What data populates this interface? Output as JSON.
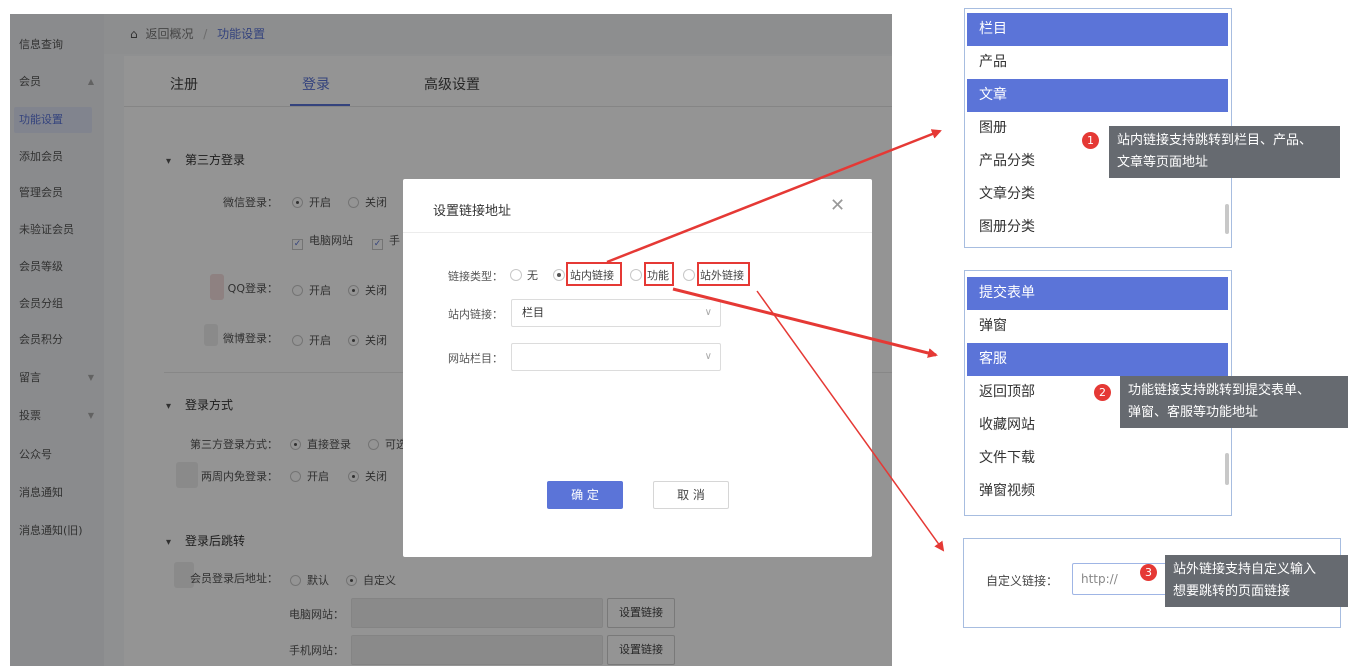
{
  "sidebar": {
    "items": [
      {
        "label": "信息查询"
      },
      {
        "label": "会员",
        "caret": "▲"
      },
      {
        "label": "功能设置"
      },
      {
        "label": "添加会员"
      },
      {
        "label": "管理会员"
      },
      {
        "label": "未验证会员"
      },
      {
        "label": "会员等级"
      },
      {
        "label": "会员分组"
      },
      {
        "label": "会员积分"
      },
      {
        "label": "留言",
        "caret": "▼"
      },
      {
        "label": "投票",
        "caret": "▼"
      },
      {
        "label": "公众号"
      },
      {
        "label": "消息通知"
      },
      {
        "label": "消息通知(旧)"
      }
    ]
  },
  "breadcrumb": {
    "back": "返回概况",
    "sep": "/",
    "current": "功能设置"
  },
  "tabs": [
    {
      "label": "注册"
    },
    {
      "label": "登录"
    },
    {
      "label": "高级设置"
    }
  ],
  "sections": {
    "third_party": {
      "title": "第三方登录",
      "wechat_label": "微信登录：",
      "qq_label": "QQ登录：",
      "weibo_label": "微博登录：",
      "on": "开启",
      "off": "关闭",
      "pc_site": "电脑网站",
      "mobile_partial": "手"
    },
    "login_method": {
      "title": "登录方式",
      "third_method_label": "第三方登录方式：",
      "direct": "直接登录",
      "optional_partial": "可选",
      "two_week_label": "两周内免登录：",
      "on": "开启",
      "off": "关闭"
    },
    "redirect": {
      "title": "登录后跳转",
      "addr_label": "会员登录后地址：",
      "default": "默认",
      "custom": "自定义",
      "pc_label": "电脑网站：",
      "mobile_label": "手机网站：",
      "set_link": "设置链接"
    }
  },
  "modal": {
    "title": "设置链接地址",
    "close": "✕",
    "type_label": "链接类型：",
    "options": [
      {
        "label": "无"
      },
      {
        "label": "站内链接"
      },
      {
        "label": "功能"
      },
      {
        "label": "站外链接"
      }
    ],
    "inner_label": "站内链接：",
    "inner_value": "栏目",
    "column_label": "网站栏目：",
    "column_value": "",
    "ok": "确 定",
    "cancel": "取 消"
  },
  "panel1": {
    "items": [
      {
        "label": "栏目"
      },
      {
        "label": "产品"
      },
      {
        "label": "文章"
      },
      {
        "label": "图册"
      },
      {
        "label": "产品分类"
      },
      {
        "label": "文章分类"
      },
      {
        "label": "图册分类"
      }
    ],
    "badge": "1",
    "tip": [
      "站内链接支持跳转到栏目、产品、",
      "文章等页面地址"
    ]
  },
  "panel2": {
    "items": [
      {
        "label": "提交表单"
      },
      {
        "label": "弹窗"
      },
      {
        "label": "客服"
      },
      {
        "label": "返回顶部"
      },
      {
        "label": "收藏网站"
      },
      {
        "label": "文件下载"
      },
      {
        "label": "弹窗视频"
      }
    ],
    "badge": "2",
    "tip": [
      "功能链接支持跳转到提交表单、",
      "弹窗、客服等功能地址"
    ]
  },
  "panel3": {
    "label": "自定义链接：",
    "input_placeholder": "http://",
    "badge": "3",
    "tip": [
      "站外链接支持自定义输入",
      "想要跳转的页面链接"
    ]
  },
  "colors": {
    "accent": "#5b74d8",
    "highlight": "#e53935",
    "tip_bg": "#666a70"
  }
}
